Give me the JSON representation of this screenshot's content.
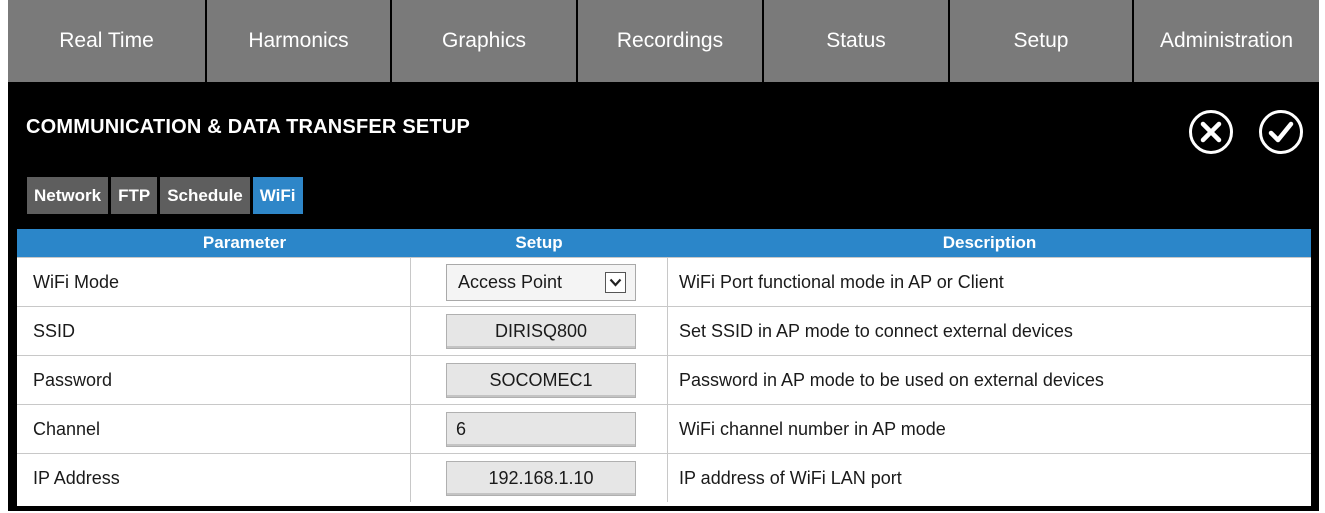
{
  "nav": {
    "items": [
      {
        "label": "Real Time"
      },
      {
        "label": "Harmonics"
      },
      {
        "label": "Graphics"
      },
      {
        "label": "Recordings"
      },
      {
        "label": "Status"
      },
      {
        "label": "Setup"
      },
      {
        "label": "Administration"
      }
    ]
  },
  "page": {
    "title": "COMMUNICATION & DATA TRANSFER SETUP",
    "cancel_icon": "close-circle-icon",
    "confirm_icon": "check-circle-icon"
  },
  "subtabs": [
    {
      "label": "Network",
      "active": false
    },
    {
      "label": "FTP",
      "active": false
    },
    {
      "label": "Schedule",
      "active": false
    },
    {
      "label": "WiFi",
      "active": true
    }
  ],
  "table": {
    "headers": {
      "parameter": "Parameter",
      "setup": "Setup",
      "description": "Description"
    },
    "rows": [
      {
        "parameter": "WiFi Mode",
        "setup": "Access Point",
        "description": "WiFi Port functional mode in AP or Client"
      },
      {
        "parameter": "SSID",
        "setup": "DIRISQ800",
        "description": "Set SSID in AP mode to connect external devices"
      },
      {
        "parameter": "Password",
        "setup": "SOCOMEC1",
        "description": "Password in AP mode to be used on external devices"
      },
      {
        "parameter": "Channel",
        "setup": "6",
        "description": "WiFi channel number in AP mode"
      },
      {
        "parameter": "IP Address",
        "setup": "192.168.1.10",
        "description": "IP address of WiFi LAN port"
      }
    ]
  },
  "colors": {
    "background": "#000000",
    "nav_button": "#7a7a7a",
    "accent_blue": "#2b86c9",
    "inactive_tab": "#5e5e5e"
  }
}
